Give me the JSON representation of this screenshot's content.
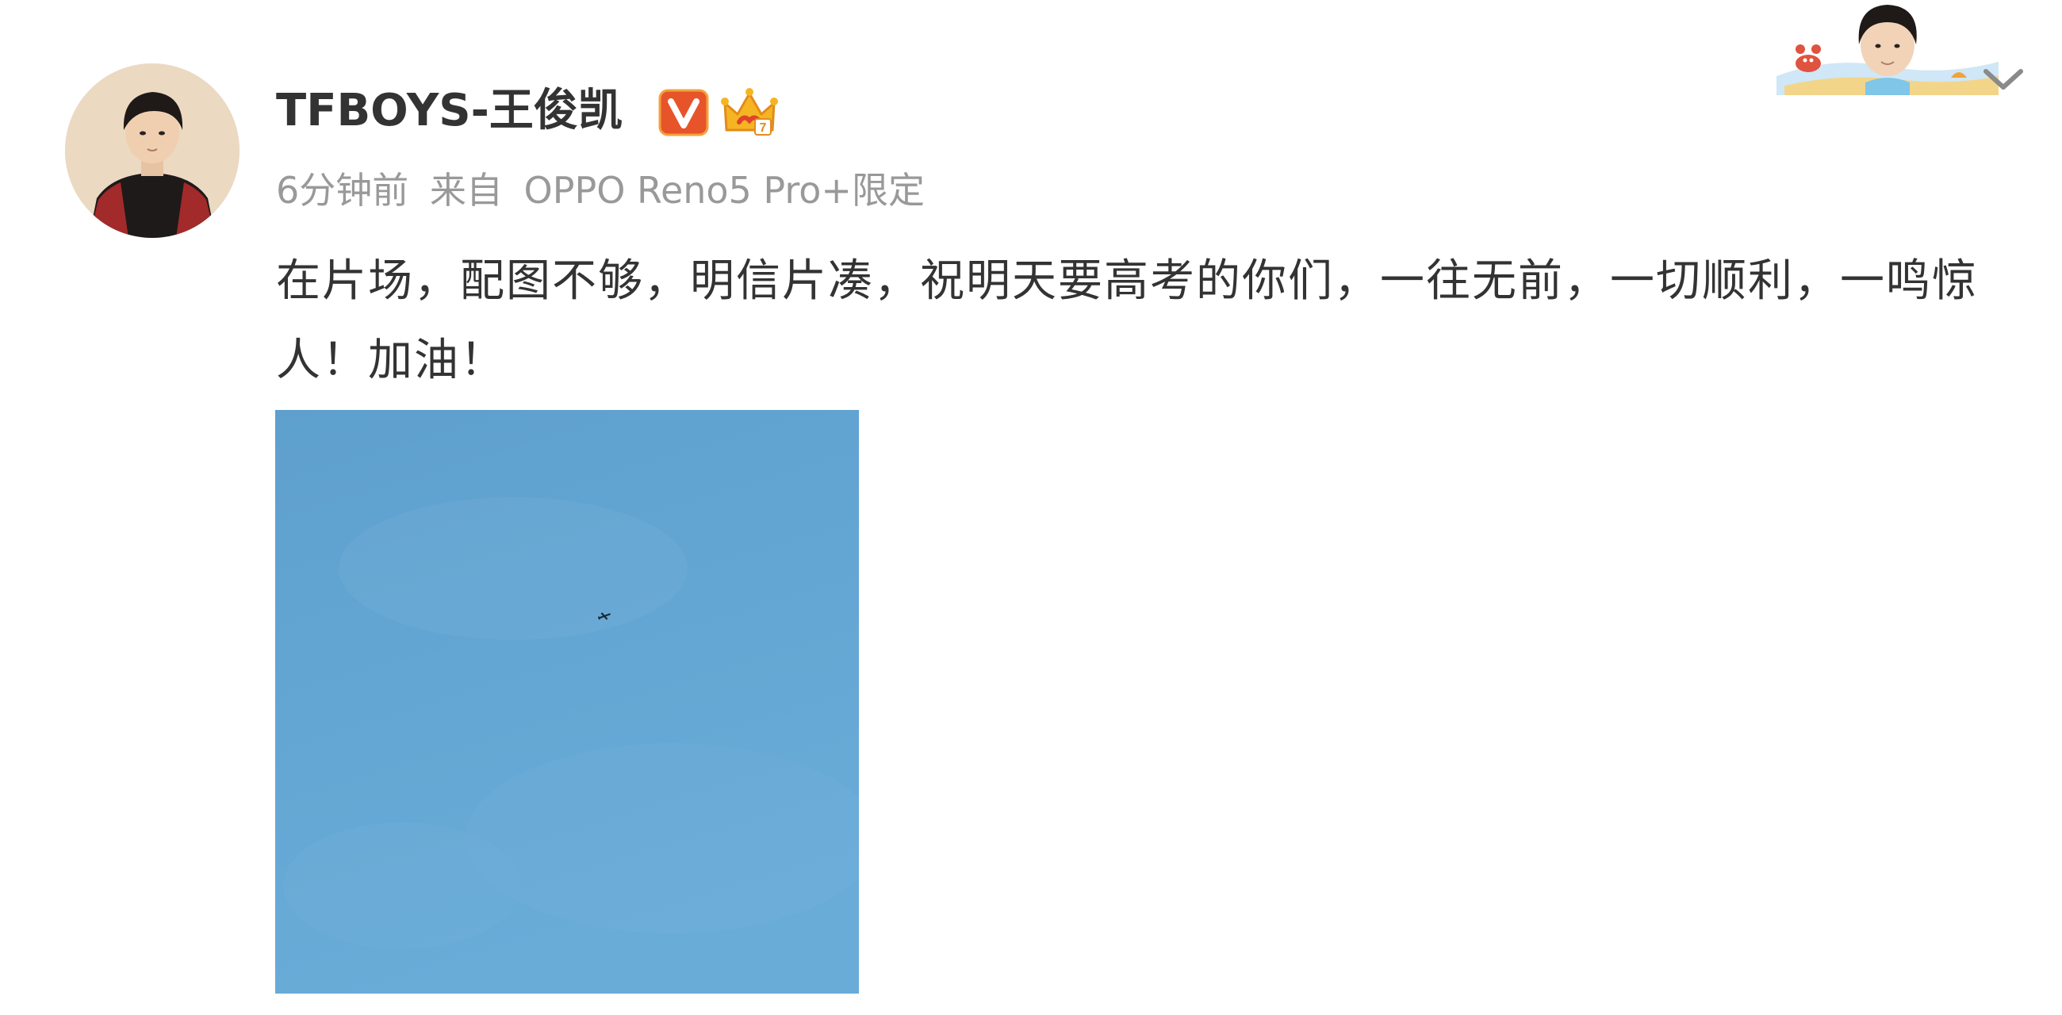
{
  "post": {
    "author": {
      "name": "TFBOYS-王俊凯",
      "verified_icon": "verified-v-icon",
      "membership_icon": "vip-crown-icon",
      "avatar_icon": "user-avatar"
    },
    "meta": {
      "time": "6分钟前",
      "source_prefix": "来自",
      "source": "OPPO Reno5 Pro+限定"
    },
    "text": "在片场，配图不够，明信片凑，祝明天要高考的你们，一往无前，一切顺利，一鸣惊人！加油！",
    "image": {
      "icon": "sky-photo",
      "color": "#63a6d3"
    },
    "menu_icon": "chevron-down-icon",
    "decoration_icon": "card-decoration"
  },
  "colors": {
    "name": "#333333",
    "meta": "#999999",
    "text": "#333333",
    "verified": "#e8542a",
    "crown": "#f5b523"
  }
}
